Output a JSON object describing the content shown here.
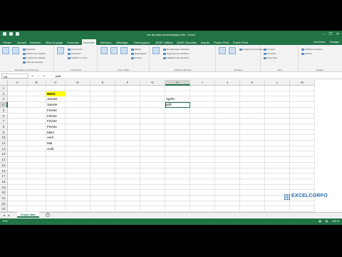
{
  "window": {
    "title": "les-ab-alas-chronologique.xlsx - Excel",
    "controls": [
      "–",
      "❐",
      "✕"
    ]
  },
  "tabs": [
    {
      "label": "Fichier",
      "active": false
    },
    {
      "label": "Accueil",
      "active": false
    },
    {
      "label": "Insertion",
      "active": false
    },
    {
      "label": "Mise en page",
      "active": false
    },
    {
      "label": "Formules",
      "active": false
    },
    {
      "label": "Données",
      "active": true
    },
    {
      "label": "Révision",
      "active": false
    },
    {
      "label": "Affichage",
      "active": false
    },
    {
      "label": "Développeur",
      "active": false
    },
    {
      "label": "ASAP Utilities",
      "active": false
    },
    {
      "label": "ASAP Favorites",
      "active": false
    },
    {
      "label": "Inquire",
      "active": false
    },
    {
      "label": "Power Pivot",
      "active": false
    },
    {
      "label": "Power Pivot",
      "active": false
    }
  ],
  "tabbar_right": [
    "Connexion",
    "Partager"
  ],
  "ribbon_groups": [
    {
      "label": "Récupérer et transformer",
      "items": [
        "Requêtes",
        "Afficher les requêtes",
        "À partir d'un tableau",
        "Sources récentes"
      ]
    },
    {
      "label": "Connexions",
      "items": [
        "Connexions",
        "Propriétés",
        "Modifier les liens"
      ]
    },
    {
      "label": "Trier et filtrer",
      "items": [
        "Trier",
        "Filtrer",
        "Effacer",
        "Réappliquer",
        "Avancé"
      ]
    },
    {
      "label": "Outils de données",
      "items": [
        "Convertir",
        "Remplissage instantané",
        "Supprimer les doublons",
        "Validation des données"
      ]
    },
    {
      "label": "Prévision",
      "items": [
        "Analyse de scénarios",
        "Feuille de prévision"
      ]
    },
    {
      "label": "Plan",
      "items": [
        "Grouper",
        "Dissocier",
        "Sous-total"
      ]
    },
    {
      "label": "Analyse",
      "items": [
        "Utilitaire d'analyse",
        "Solveur"
      ]
    }
  ],
  "formula_bar": {
    "name_box": "H4",
    "content": "juillt"
  },
  "columns": [
    "A",
    "B",
    "C",
    "D",
    "E",
    "F",
    "G",
    "H",
    "I",
    "J",
    "K",
    "L",
    "M"
  ],
  "selected_column": "H",
  "selected_row": 4,
  "rows": [
    "1",
    "2",
    "3",
    "4",
    "5",
    "6",
    "7",
    "8",
    "9",
    "10",
    "11",
    "12",
    "13",
    "14",
    "15",
    "16",
    "17",
    "18",
    "19",
    "20",
    "21",
    "22",
    "23",
    "24",
    "25"
  ],
  "cells": {
    "C2": "MOIS",
    "C3": "Janvier",
    "C4": "Janvier",
    "C5": "Février",
    "C6": "Février",
    "C7": "Février",
    "C8": "Février",
    "C9": "Mars",
    "C10": "Avril",
    "C11": "Mai",
    "C12": "Août",
    "H3": "Après",
    "H4": "juillt"
  },
  "tooltip": "Après",
  "highlight_color": "#ffff00",
  "sheet_tabs": [
    {
      "label": "tri par date",
      "active": true
    }
  ],
  "status": {
    "ready": "Prêt",
    "zoom": "100 %"
  },
  "watermark": {
    "brand": "EXCELCORPO"
  }
}
